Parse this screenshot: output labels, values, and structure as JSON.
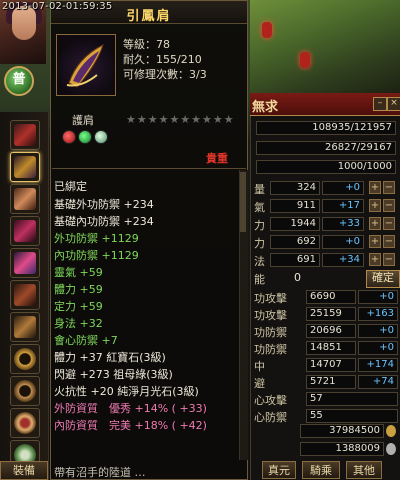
{
  "timestamp": "2013-07-02-01:59:35",
  "portrait": {
    "badge": "普"
  },
  "tooltip": {
    "title": "引鳳肩",
    "level": "等級：78",
    "durability": "耐久：155/210",
    "repairs": "可修理次數：3/3",
    "slot_name": "護肩",
    "stars": "★★★★★★★★★★",
    "rarity": "貴重",
    "bound": "已綁定",
    "lines": [
      {
        "text": "基礎外功防禦 +234",
        "color": "white"
      },
      {
        "text": "基礎內功防禦 +234",
        "color": "white"
      },
      {
        "text": "外功防禦 +1129",
        "color": "green"
      },
      {
        "text": "內功防禦 +1129",
        "color": "green"
      },
      {
        "text": "靈氣 +59",
        "color": "green"
      },
      {
        "text": "體力 +59",
        "color": "green"
      },
      {
        "text": "定力 +59",
        "color": "green"
      },
      {
        "text": "身法 +32",
        "color": "green"
      },
      {
        "text": "會心防禦 +7",
        "color": "green"
      },
      {
        "text": "體力 +37 紅寶石(3級)",
        "color": "white"
      },
      {
        "text": "閃避 +273 祖母綠(3級)",
        "color": "white"
      },
      {
        "text": "火抗性 +20 純淨月光石(3級)",
        "color": "white"
      },
      {
        "text": "外防資質　優秀 +14% ( +33)",
        "color": "pink"
      },
      {
        "text": "內防資質　完美 +18% ( +42)",
        "color": "pink"
      }
    ],
    "bottom_text": "帶有沼手的陸道 …"
  },
  "right_panel": {
    "title": "無求",
    "top_values": [
      "108935/121957",
      "26827/29167",
      "1000/1000"
    ],
    "attr_rows": [
      {
        "label": "量",
        "value": "324",
        "bonus": "+0"
      },
      {
        "label": "氣",
        "value": "911",
        "bonus": "+17"
      },
      {
        "label": "力",
        "value": "1944",
        "bonus": "+33"
      },
      {
        "label": "力",
        "value": "692",
        "bonus": "+0"
      },
      {
        "label": "法",
        "value": "691",
        "bonus": "+34"
      }
    ],
    "potential_label": "能",
    "potential_value": "0",
    "confirm": "確定",
    "combat_rows": [
      {
        "label": "功攻擊",
        "value": "6690",
        "bonus": "+0"
      },
      {
        "label": "功攻擊",
        "value": "25159",
        "bonus": "+163"
      },
      {
        "label": "功防禦",
        "value": "20696",
        "bonus": "+0"
      },
      {
        "label": "功防禦",
        "value": "14851",
        "bonus": "+0"
      },
      {
        "label": "中",
        "value": "14707",
        "bonus": "+174"
      },
      {
        "label": "避",
        "value": "5721",
        "bonus": "+74"
      },
      {
        "label": "心攻擊",
        "value": "57",
        "bonus": ""
      },
      {
        "label": "心防禦",
        "value": "55",
        "bonus": ""
      }
    ],
    "money1": "37984500",
    "money2": "1388009",
    "tabs": [
      "真元",
      "騎乘",
      "其他"
    ]
  },
  "equip_tab": "裝備",
  "colors": {
    "gold_title": "#ffd86a",
    "green_stat": "#7fd85a",
    "pink_stat": "#f07ab4",
    "rarity_red": "#e2352a",
    "blue_bonus": "#6ac4ff"
  }
}
